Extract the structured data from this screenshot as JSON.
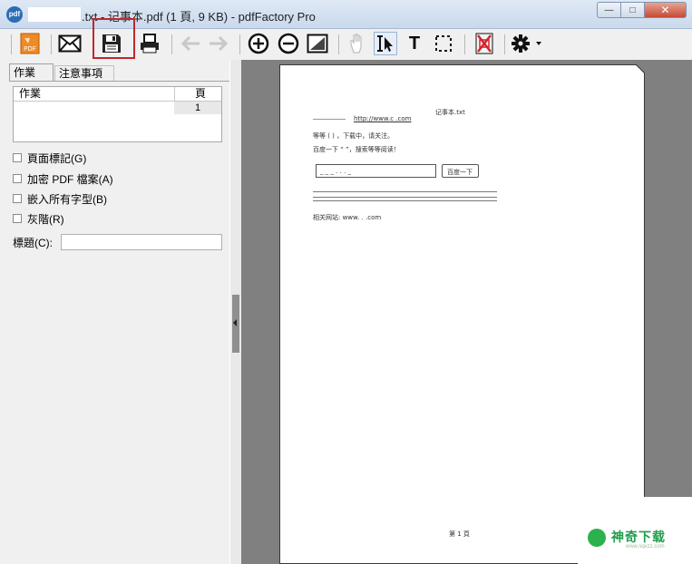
{
  "window": {
    "title": ".txt - 记事本.pdf (1 頁, 9 KB) - pdfFactory Pro",
    "app_icon_text": "pdf"
  },
  "window_buttons": {
    "minimize": "—",
    "maximize": "□",
    "close": "✕"
  },
  "toolbar": {
    "buttons": [
      {
        "name": "pdf-logo-icon",
        "label": "PDF"
      },
      {
        "name": "email-icon"
      },
      {
        "name": "save-icon"
      },
      {
        "name": "print-icon"
      },
      {
        "name": "back-arrow-icon"
      },
      {
        "name": "forward-arrow-icon"
      },
      {
        "name": "zoom-in-icon"
      },
      {
        "name": "zoom-out-icon"
      },
      {
        "name": "fit-page-icon"
      },
      {
        "name": "hand-icon"
      },
      {
        "name": "text-select-icon"
      },
      {
        "name": "text-tool-icon",
        "label": "T"
      },
      {
        "name": "marquee-select-icon"
      },
      {
        "name": "delete-page-icon"
      },
      {
        "name": "settings-gear-icon"
      }
    ]
  },
  "tabs": [
    {
      "label": "作業"
    },
    {
      "label": "注意事項"
    }
  ],
  "job_table": {
    "headers": [
      "作業",
      "頁"
    ],
    "rows": [
      {
        "job": "",
        "pages": "1"
      }
    ]
  },
  "options": [
    {
      "label": "頁面標記(G)",
      "checked": false
    },
    {
      "label": "加密 PDF 檔案(A)",
      "checked": false
    },
    {
      "label": "嵌入所有字型(B)",
      "checked": false
    },
    {
      "label": "灰階(R)",
      "checked": false
    }
  ],
  "title_field": {
    "label": "標題(C):",
    "value": ""
  },
  "document": {
    "header_right": "记事本.txt",
    "line1_link": "http://www.c      .com",
    "line2": "等等 (     ) ，下载中，请关注。",
    "line3": "百度一下 “                ”，搜索等等阅读！",
    "search_box_text": "_ _ _ . . . _",
    "search_button": "百度一下",
    "footer_line": "相关网站: www.  .  .com",
    "page_number": "第 1 頁"
  },
  "watermark": {
    "text": "神奇下载",
    "url": "www.sqxzz.com"
  }
}
